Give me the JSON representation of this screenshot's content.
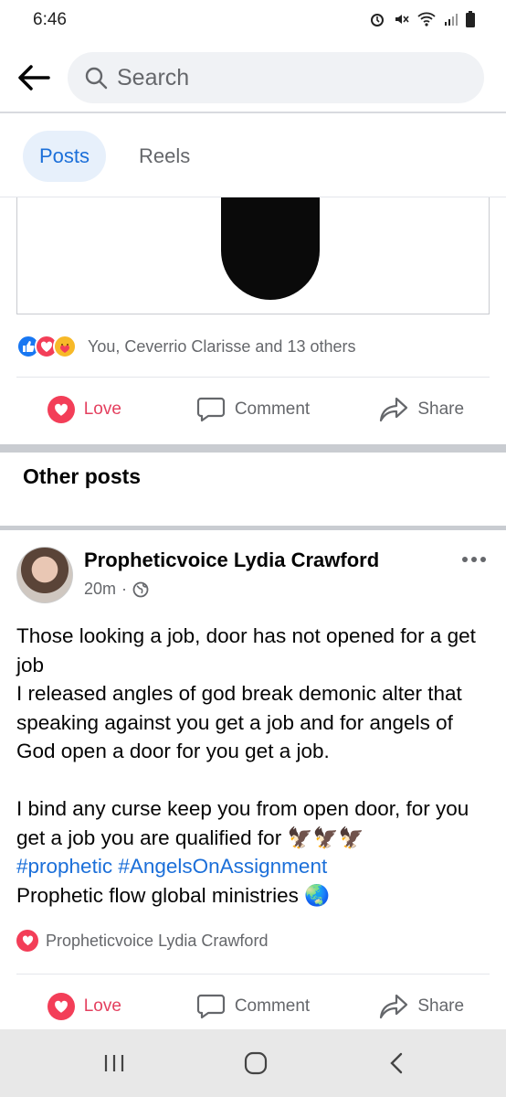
{
  "status_bar": {
    "time": "6:46"
  },
  "search": {
    "placeholder": "Search"
  },
  "tabs": [
    {
      "label": "Posts",
      "active": true
    },
    {
      "label": "Reels",
      "active": false
    }
  ],
  "first_post": {
    "reactions_text": "You, Ceverrio Clarisse and 13 others",
    "actions": {
      "love": "Love",
      "comment": "Comment",
      "share": "Share"
    }
  },
  "other_posts_heading": "Other posts",
  "second_post": {
    "author": "Propheticvoice Lydia Crawford",
    "time": "20m",
    "body_lines": [
      "Those looking a job, door has not opened for a get job",
      "I released angles of god break demonic alter that speaking against you get a job and for angels of God open a door for you get a job.",
      "I bind any curse keep you from open door, for you get a job you are qualified for 🦅🦅🦅"
    ],
    "hashtags": "#prophetic #AngelsOnAssignment",
    "closing": "Prophetic flow global ministries 🌏",
    "loved_by": "Propheticvoice Lydia Crawford",
    "actions": {
      "love": "Love",
      "comment": "Comment",
      "share": "Share"
    }
  },
  "colors": {
    "accent": "#1b6fd9",
    "love": "#f33e58",
    "muted": "#65676b"
  }
}
